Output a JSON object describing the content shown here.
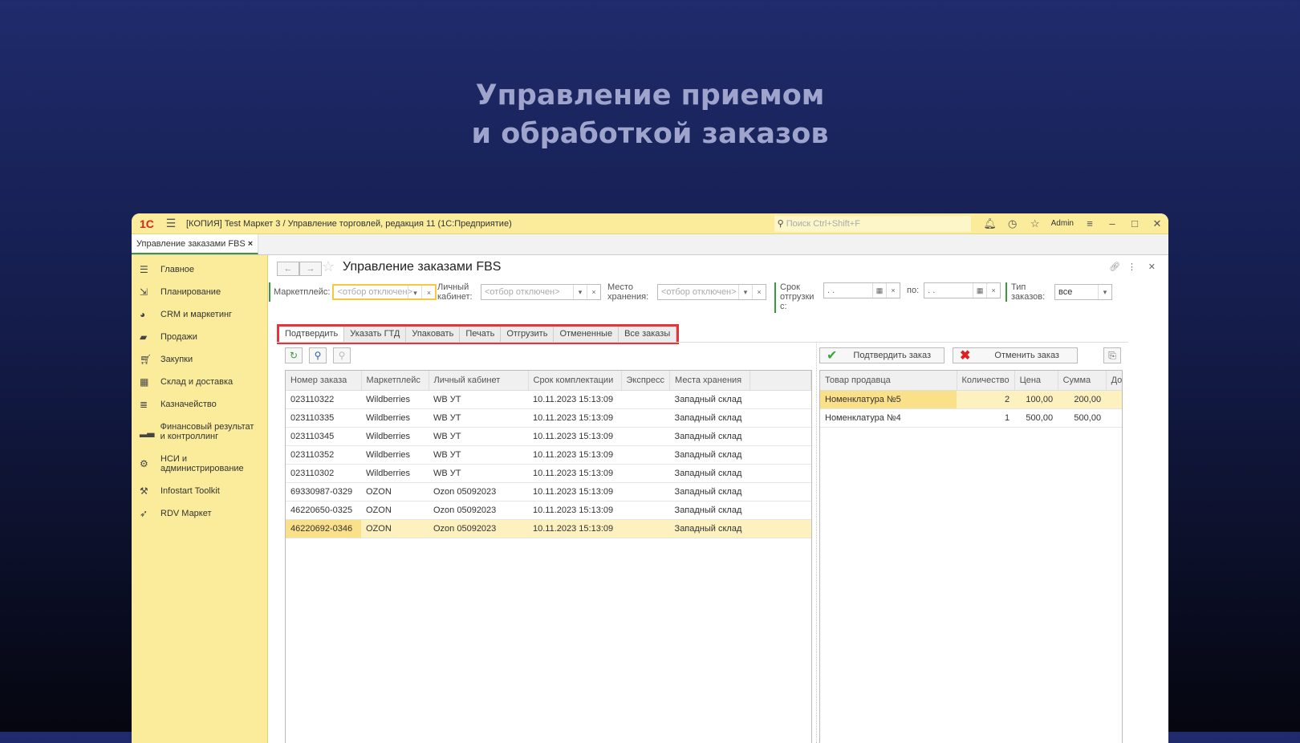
{
  "hero": {
    "line1": "Управление приемом",
    "line2": "и обработкой заказов"
  },
  "window": {
    "logo": "1С",
    "title": "[КОПИЯ] Test Маркет 3 / Управление торговлей, редакция 11  (1С:Предприятие)",
    "search_placeholder": "Поиск Ctrl+Shift+F",
    "user": "Admin"
  },
  "open_tab": {
    "label": "Управление заказами FBS",
    "close": "×"
  },
  "sidebar": {
    "items": [
      {
        "label": "Главное",
        "icon": "menu-icon"
      },
      {
        "label": "Планирование",
        "icon": "planning-icon"
      },
      {
        "label": "CRM и маркетинг",
        "icon": "pie-icon"
      },
      {
        "label": "Продажи",
        "icon": "bag-icon"
      },
      {
        "label": "Закупки",
        "icon": "cart-icon"
      },
      {
        "label": "Склад и доставка",
        "icon": "warehouse-icon"
      },
      {
        "label": "Казначейство",
        "icon": "coins-icon"
      },
      {
        "label": "Финансовый результат и контроллинг",
        "icon": "bar-chart-icon"
      },
      {
        "label": "НСИ и администрирование",
        "icon": "gear-icon"
      },
      {
        "label": "Infostart Toolkit",
        "icon": "tools-icon"
      },
      {
        "label": "RDV Маркет",
        "icon": "rocket-icon"
      }
    ]
  },
  "form": {
    "title": "Управление заказами FBS",
    "filters": {
      "marketplace_label": "Маркетплейс:",
      "marketplace_placeholder": "<отбор отключен>",
      "cabinet_label": "Личный кабинет:",
      "cabinet_placeholder": "<отбор отключен>",
      "storage_label": "Место хранения:",
      "storage_placeholder": "<отбор отключен>",
      "ship_from_label": "Срок отгрузки с:",
      "ship_from_value": " .  . ",
      "ship_to_label": "по:",
      "ship_to_value": " .  . ",
      "type_label": "Тип заказов:",
      "type_value": "все"
    },
    "tabs": [
      "Подтвердить",
      "Указать ГТД",
      "Упаковать",
      "Печать",
      "Отгрузить",
      "Отмененные",
      "Все заказы"
    ],
    "active_tab": "Подтвердить",
    "confirm_button": "Подтвердить заказ",
    "cancel_button": "Отменить заказ"
  },
  "orders": {
    "columns": [
      "Номер заказа",
      "Маркетплейс",
      "Личный кабинет",
      "Срок комплектации",
      "Экспресс",
      "Места хранения"
    ],
    "rows": [
      [
        "023110322",
        "Wildberries",
        "WB УТ",
        "10.11.2023 15:13:09",
        "",
        "Западный склад"
      ],
      [
        "023110335",
        "Wildberries",
        "WB УТ",
        "10.11.2023 15:13:09",
        "",
        "Западный склад"
      ],
      [
        "023110345",
        "Wildberries",
        "WB УТ",
        "10.11.2023 15:13:09",
        "",
        "Западный склад"
      ],
      [
        "023110352",
        "Wildberries",
        "WB УТ",
        "10.11.2023 15:13:09",
        "",
        "Западный склад"
      ],
      [
        "023110302",
        "Wildberries",
        "WB УТ",
        "10.11.2023 15:13:09",
        "",
        "Западный склад"
      ],
      [
        "69330987-0329",
        "OZON",
        "Ozon 05092023",
        "10.11.2023 15:13:09",
        "",
        "Западный склад"
      ],
      [
        "46220650-0325",
        "OZON",
        "Ozon 05092023",
        "10.11.2023 15:13:09",
        "",
        "Западный склад"
      ],
      [
        "46220692-0346",
        "OZON",
        "Ozon 05092023",
        "10.11.2023 15:13:09",
        "",
        "Западный склад"
      ]
    ],
    "selected_row": 7
  },
  "items": {
    "columns": [
      "Товар продавца",
      "Количество",
      "Цена",
      "Сумма",
      "Дос"
    ],
    "rows": [
      [
        "Номенклатура №5",
        "2",
        "100,00",
        "200,00",
        ""
      ],
      [
        "Номенклатура №4",
        "1",
        "500,00",
        "500,00",
        ""
      ]
    ],
    "selected_row": 0
  }
}
